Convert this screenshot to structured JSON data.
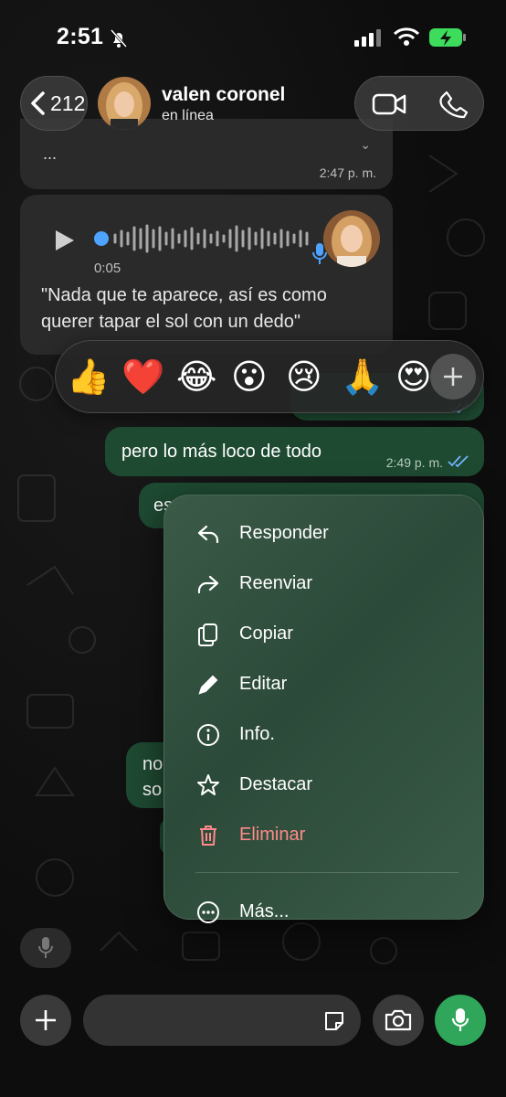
{
  "status_bar": {
    "time": "2:51"
  },
  "header": {
    "back_count": "212",
    "contact_name": "valen coronel",
    "contact_status": "en línea"
  },
  "messages": {
    "top": {
      "ellipsis": "...",
      "time": "2:47 p. m."
    },
    "voice": {
      "duration": "0:05",
      "transcript": "\"Nada que te aparece, así es como querer tapar el sol con un dedo\""
    },
    "out_1": {
      "text": "pero lo más loco de todo",
      "time": "2:49 p. m."
    },
    "out_2": {
      "text": "es"
    },
    "in_partial": {
      "line1": "no",
      "line2": "so"
    }
  },
  "reactions": [
    "👍",
    "❤️",
    "😂",
    "😮",
    "😢",
    "🙏",
    "😍"
  ],
  "menu": {
    "items": [
      {
        "label": "Responder",
        "icon": "reply-icon"
      },
      {
        "label": "Reenviar",
        "icon": "forward-icon"
      },
      {
        "label": "Copiar",
        "icon": "copy-icon"
      },
      {
        "label": "Editar",
        "icon": "pencil-icon"
      },
      {
        "label": "Info.",
        "icon": "info-icon"
      },
      {
        "label": "Destacar",
        "icon": "star-icon"
      },
      {
        "label": "Eliminar",
        "icon": "trash-icon"
      },
      {
        "label": "Más...",
        "icon": "more-icon"
      }
    ]
  },
  "colors": {
    "accent_green": "#2fa65a",
    "danger": "#ff8a8a",
    "tick_blue": "#6fb6ff"
  }
}
